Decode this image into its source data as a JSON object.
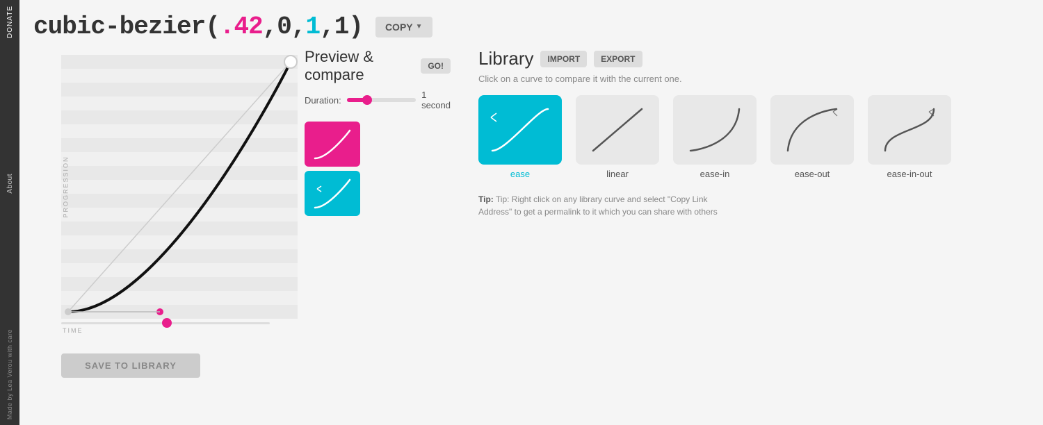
{
  "sidebar": {
    "donate_label": "DONATE",
    "about_label": "About",
    "made_label": "Made by Lea Verou with care"
  },
  "header": {
    "formula_prefix": "cubic-bezier(",
    "val1": ".42",
    "comma1": ",",
    "val2": "0",
    "comma2": ",",
    "val3": "1",
    "comma3": ",",
    "val4": "1",
    "formula_suffix": ")",
    "copy_label": "COPY"
  },
  "preview": {
    "title": "Preview & compare",
    "go_label": "GO!",
    "duration_label": "Duration:",
    "duration_value": "1 second",
    "save_label": "SAVE TO LIBRARY"
  },
  "library": {
    "title": "Library",
    "import_label": "IMPORT",
    "export_label": "EXPORT",
    "subtitle": "Click on a curve to compare it with the current one.",
    "curves": [
      {
        "name": "ease",
        "selected": true
      },
      {
        "name": "linear",
        "selected": false
      },
      {
        "name": "ease-in",
        "selected": false
      },
      {
        "name": "ease-out",
        "selected": false
      },
      {
        "name": "ease-in-out",
        "selected": false
      }
    ],
    "tip": "Tip: Right click on any library curve and select \"Copy Link Address\" to get a permalink to it which you can share with others"
  }
}
